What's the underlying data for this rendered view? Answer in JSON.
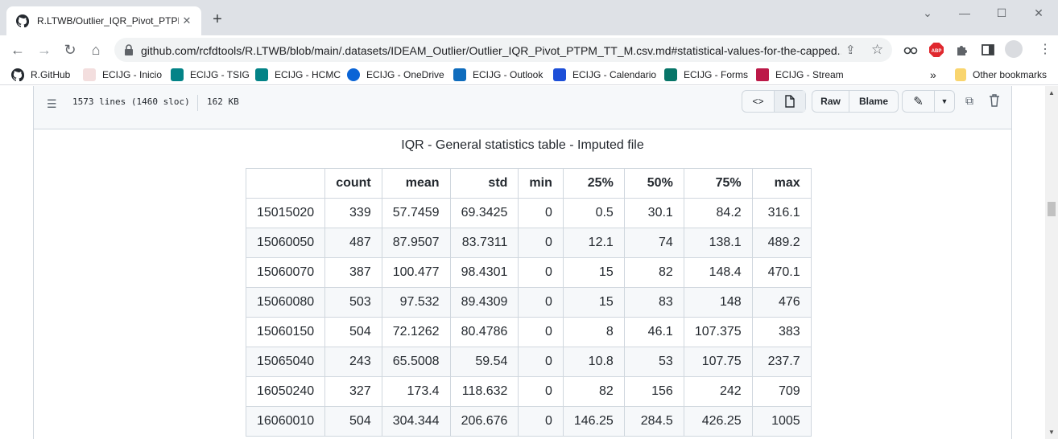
{
  "browser": {
    "tab_title": "R.LTWB/Outlier_IQR_Pivot_PTPM_",
    "url": "github.com/rcfdtools/R.LTWB/blob/main/.datasets/IDEAM_Outlier/Outlier_IQR_Pivot_PTPM_TT_M.csv.md#statistical-values-for-the-capped...",
    "bookmarks": [
      {
        "label": "R.GitHub",
        "icon": "github-icon",
        "color": "#24292f"
      },
      {
        "label": "ECIJG - Inicio",
        "icon": "page-icon",
        "color": "#e8c4c4"
      },
      {
        "label": "ECIJG - TSIG",
        "icon": "sharepoint-icon",
        "color": "#038387"
      },
      {
        "label": "ECIJG - HCMC",
        "icon": "sharepoint-icon",
        "color": "#038387"
      },
      {
        "label": "ECIJG - OneDrive",
        "icon": "onedrive-icon",
        "color": "#0a64d6"
      },
      {
        "label": "ECIJG - Outlook",
        "icon": "outlook-icon",
        "color": "#0f6cbd"
      },
      {
        "label": "ECIJG - Calendario",
        "icon": "calendar-icon",
        "color": "#1d4fd8"
      },
      {
        "label": "ECIJG - Forms",
        "icon": "forms-icon",
        "color": "#077568"
      },
      {
        "label": "ECIJG - Stream",
        "icon": "stream-icon",
        "color": "#bc1948"
      }
    ],
    "more_bookmarks": "»",
    "other_bookmarks": "Other bookmarks",
    "abp_label": "ABP"
  },
  "file": {
    "lines_info": "1573 lines (1460 sloc)",
    "size": "162 KB",
    "raw_label": "Raw",
    "blame_label": "Blame"
  },
  "doc": {
    "title": "IQR - General statistics table - Imputed file",
    "columns": [
      "",
      "count",
      "mean",
      "std",
      "min",
      "25%",
      "50%",
      "75%",
      "max"
    ],
    "rows": [
      [
        "15015020",
        "339",
        "57.7459",
        "69.3425",
        "0",
        "0.5",
        "30.1",
        "84.2",
        "316.1"
      ],
      [
        "15060050",
        "487",
        "87.9507",
        "83.7311",
        "0",
        "12.1",
        "74",
        "138.1",
        "489.2"
      ],
      [
        "15060070",
        "387",
        "100.477",
        "98.4301",
        "0",
        "15",
        "82",
        "148.4",
        "470.1"
      ],
      [
        "15060080",
        "503",
        "97.532",
        "89.4309",
        "0",
        "15",
        "83",
        "148",
        "476"
      ],
      [
        "15060150",
        "504",
        "72.1262",
        "80.4786",
        "0",
        "8",
        "46.1",
        "107.375",
        "383"
      ],
      [
        "15065040",
        "243",
        "65.5008",
        "59.54",
        "0",
        "10.8",
        "53",
        "107.75",
        "237.7"
      ],
      [
        "16050240",
        "327",
        "173.4",
        "118.632",
        "0",
        "82",
        "156",
        "242",
        "709"
      ],
      [
        "16060010",
        "504",
        "304.344",
        "206.676",
        "0",
        "146.25",
        "284.5",
        "426.25",
        "1005"
      ]
    ]
  }
}
